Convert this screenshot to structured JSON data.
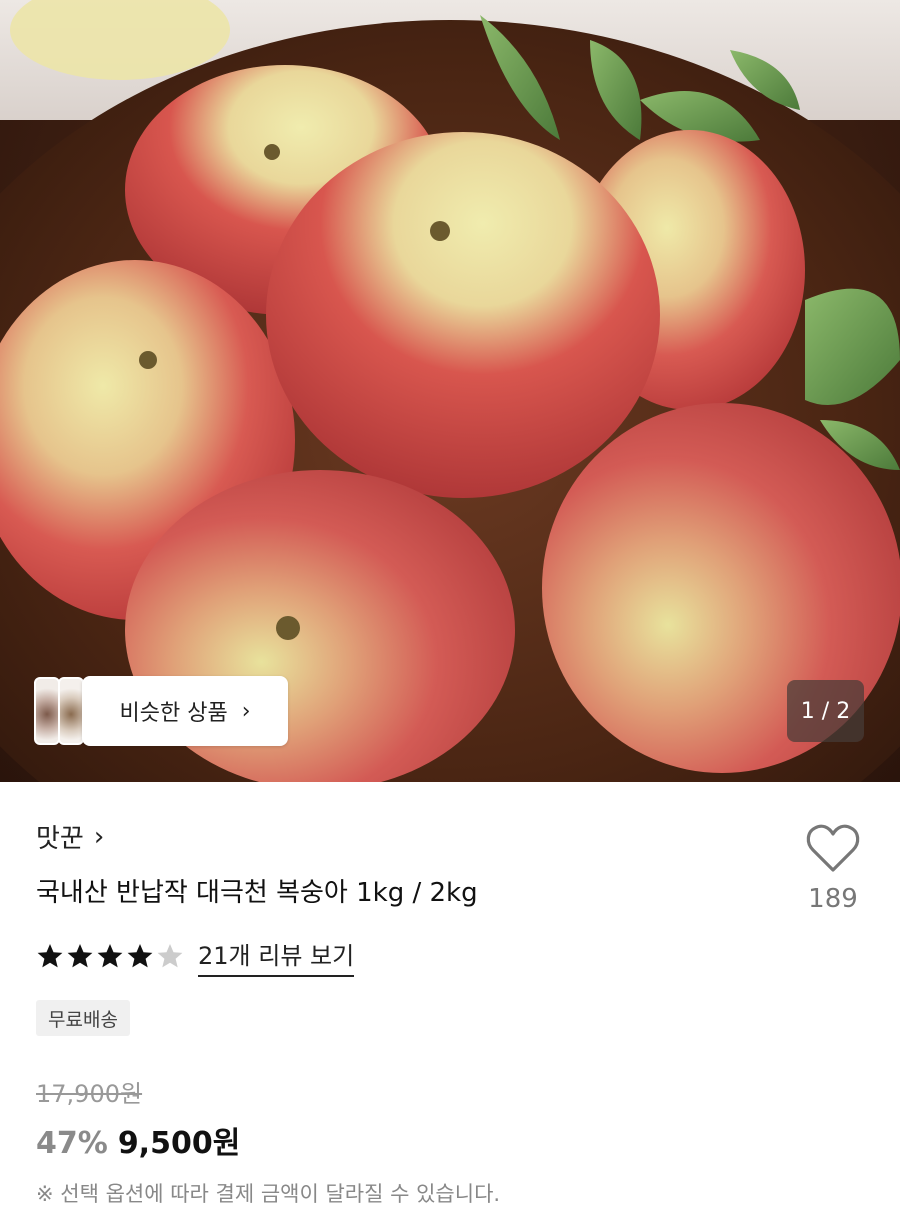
{
  "hero": {
    "similar_products_label": "비슷한 상품",
    "page_indicator": "1 / 2"
  },
  "product": {
    "brand": "맛꾼",
    "title": "국내산 반납작 대극천 복숭아 1kg / 2kg",
    "wish_count": "189",
    "rating": 4,
    "rating_max": 5,
    "review_link": "21개 리뷰 보기",
    "shipping_badge": "무료배송",
    "original_price": "17,900원",
    "discount_rate": "47%",
    "sale_price": "9,500원",
    "price_note": "※ 선택 옵션에 따라 결제 금액이 달라질 수 있습니다."
  },
  "colors": {
    "star_filled": "#111111",
    "star_empty": "#cccccc",
    "discount": "#8a8a8a"
  },
  "icons": [
    "chevron-right-icon",
    "heart-icon",
    "star-icon"
  ]
}
